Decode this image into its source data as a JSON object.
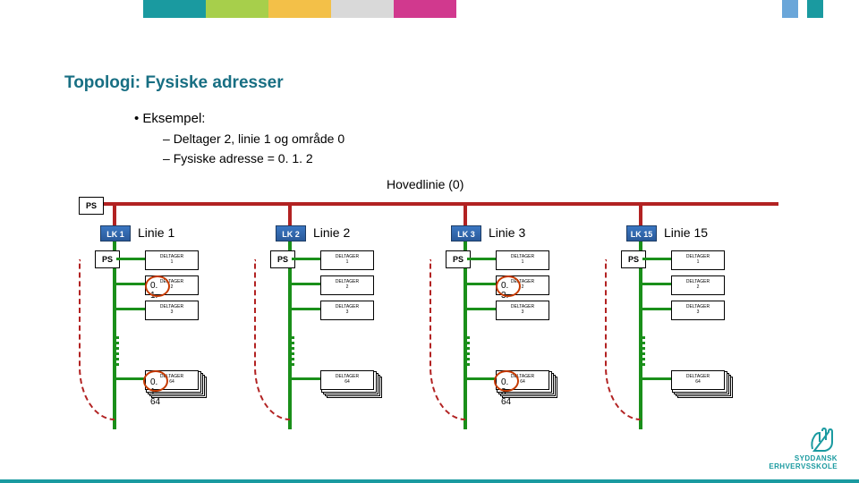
{
  "brand_colors": [
    "#1a9aa0",
    "#a7cf4b",
    "#f3c048",
    "#d9d9d9",
    "#d1398e",
    "#6aa6d9",
    "#1a9aa0"
  ],
  "title": "Topologi: Fysiske adresser",
  "bullets": {
    "eksempel": "Eksempel:",
    "line_a": "Deltager 2, linie 1 og område 0",
    "line_b": "Fysiske adresse = 0. 1. 2"
  },
  "main_line_label": "Hovedlinie (0)",
  "ps_label": "PS",
  "lines": [
    {
      "coupler": "LK 1",
      "name": "Linie 1",
      "addr2": "0. 1. 2",
      "addr64": "0. 1. 64",
      "circle2": true,
      "circle64": true
    },
    {
      "coupler": "LK 2",
      "name": "Linie 2",
      "addr2": "",
      "addr64": "",
      "circle2": false,
      "circle64": false
    },
    {
      "coupler": "LK 3",
      "name": "Linie 3",
      "addr2": "0. 3. 2",
      "addr64": "0. 3. 64",
      "circle2": true,
      "circle64": true
    },
    {
      "coupler": "LK 15",
      "name": "Linie 15",
      "addr2": "",
      "addr64": "",
      "circle2": false,
      "circle64": false
    }
  ],
  "device_labels": {
    "d1": "DELTAGER\n1",
    "d2": "DELTAGER\n2",
    "d3": "DELTAGER\n3",
    "d64": "DELTAGER\n64"
  },
  "logo_top": "SYDDANSK",
  "logo_bottom": "ERHVERVSSKOLE"
}
